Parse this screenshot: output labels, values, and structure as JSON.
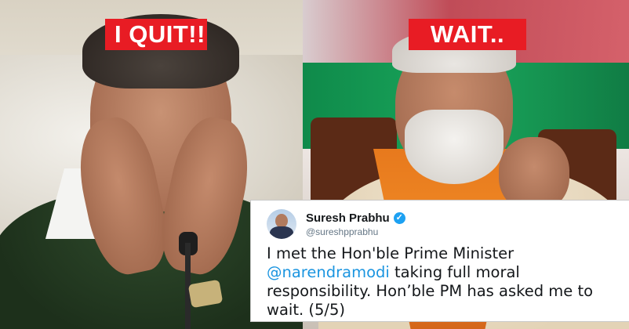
{
  "labels": {
    "left": "I QUIT!!",
    "right": "WAIT.."
  },
  "colors": {
    "label_bg": "#e81c24",
    "label_text": "#ffffff",
    "mention": "#1b95e0",
    "verified": "#1da1f2"
  },
  "tweet": {
    "author_name": "Suresh Prabhu",
    "handle": "@sureshpprabhu",
    "verified_icon": "verified-badge-icon",
    "text_before": "I met the Hon'ble Prime Minister ",
    "mention": "@narendramodi",
    "text_after": " taking full moral responsibility. Hon’ble PM has asked me to wait. (5/5)"
  }
}
